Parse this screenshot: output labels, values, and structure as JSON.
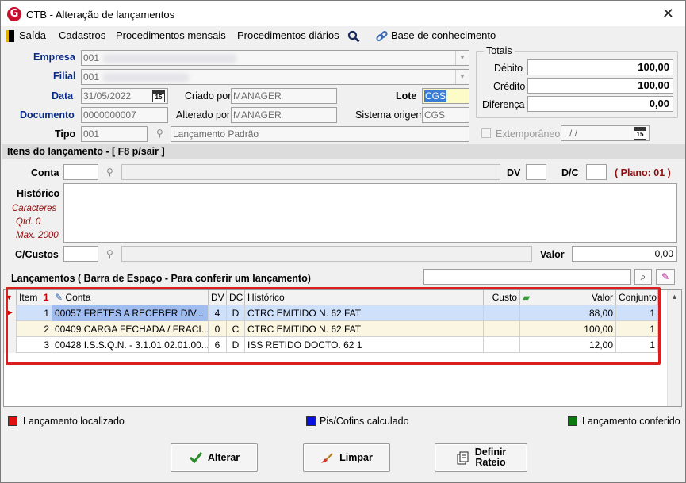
{
  "window": {
    "title": "CTB - Alteração de lançamentos",
    "close_glyph": "✕"
  },
  "menu": {
    "saida": "Saída",
    "cadastros": "Cadastros",
    "proc_mensais": "Procedimentos mensais",
    "proc_diarios": "Procedimentos diários",
    "base": "Base de conhecimento"
  },
  "header": {
    "empresa_label": "Empresa",
    "empresa_value": "001",
    "filial_label": "Filial",
    "filial_value": "001",
    "data_label": "Data",
    "data_value": "31/05/2022",
    "documento_label": "Documento",
    "documento_value": "0000000007",
    "tipo_label": "Tipo",
    "tipo_value": "001",
    "tipo_desc": "Lançamento Padrão",
    "criado_label": "Criado por",
    "criado_value": "MANAGER",
    "alterado_label": "Alterado por",
    "alterado_value": "MANAGER",
    "lote_label": "Lote",
    "lote_value": "CGS",
    "sistema_label": "Sistema origem",
    "sistema_value": "CGS",
    "calendar_glyph": "15"
  },
  "totais": {
    "title": "Totais",
    "debito_label": "Débito",
    "debito_value": "100,00",
    "credito_label": "Crédito",
    "credito_value": "100,00",
    "diferenca_label": "Diferença",
    "diferenca_value": "0,00",
    "extemporaneo_label": "Extemporâneo",
    "extemporaneo_value": "/ /"
  },
  "itens": {
    "section_title": "Itens do lançamento - [ F8 p/sair ]",
    "conta_label": "Conta",
    "dv_label": "DV",
    "dc_label": "D/C",
    "plano_label": "( Plano: 01 )",
    "historico_label": "Histórico",
    "caracteres_label": "Caracteres",
    "qtd_label": "Qtd. 0",
    "max_label": "Max. 2000",
    "ccustos_label": "C/Custos",
    "valor_label": "Valor",
    "valor_value": "0,00"
  },
  "lancamentos": {
    "title": "Lançamentos ( Barra de Espaço - Para conferir um lançamento)",
    "columns": {
      "item": "Item",
      "sort": "1",
      "conta": "Conta",
      "dv": "DV",
      "dc": "DC",
      "historico": "Histórico",
      "custo": "Custo",
      "valor": "Valor",
      "conjunto": "Conjunto"
    },
    "rows": [
      {
        "item": "1",
        "conta": "00057 FRETES A RECEBER DIV...",
        "dv": "4",
        "dc": "D",
        "historico": "CTRC EMITIDO N. 62 FAT",
        "custo": "",
        "valor": "88,00",
        "conjunto": "1"
      },
      {
        "item": "2",
        "conta": "00409 CARGA FECHADA / FRACI...",
        "dv": "0",
        "dc": "C",
        "historico": "CTRC EMITIDO N. 62 FAT",
        "custo": "",
        "valor": "100,00",
        "conjunto": "1"
      },
      {
        "item": "3",
        "conta": "00428 I.S.S.Q.N. - 3.1.01.02.01.00...",
        "dv": "6",
        "dc": "D",
        "historico": "ISS RETIDO DOCTO. 62 1",
        "custo": "",
        "valor": "12,00",
        "conjunto": "1"
      }
    ]
  },
  "legend": {
    "localizado": "Lançamento localizado",
    "piscofins": "Pis/Cofins calculado",
    "conferido": "Lançamento conferido",
    "red": "#e01010",
    "blue": "#0a10e0",
    "green": "#0a7a10"
  },
  "buttons": {
    "alterar": "Alterar",
    "limpar": "Limpar",
    "definir": "Definir",
    "rateio": "Rateio"
  }
}
